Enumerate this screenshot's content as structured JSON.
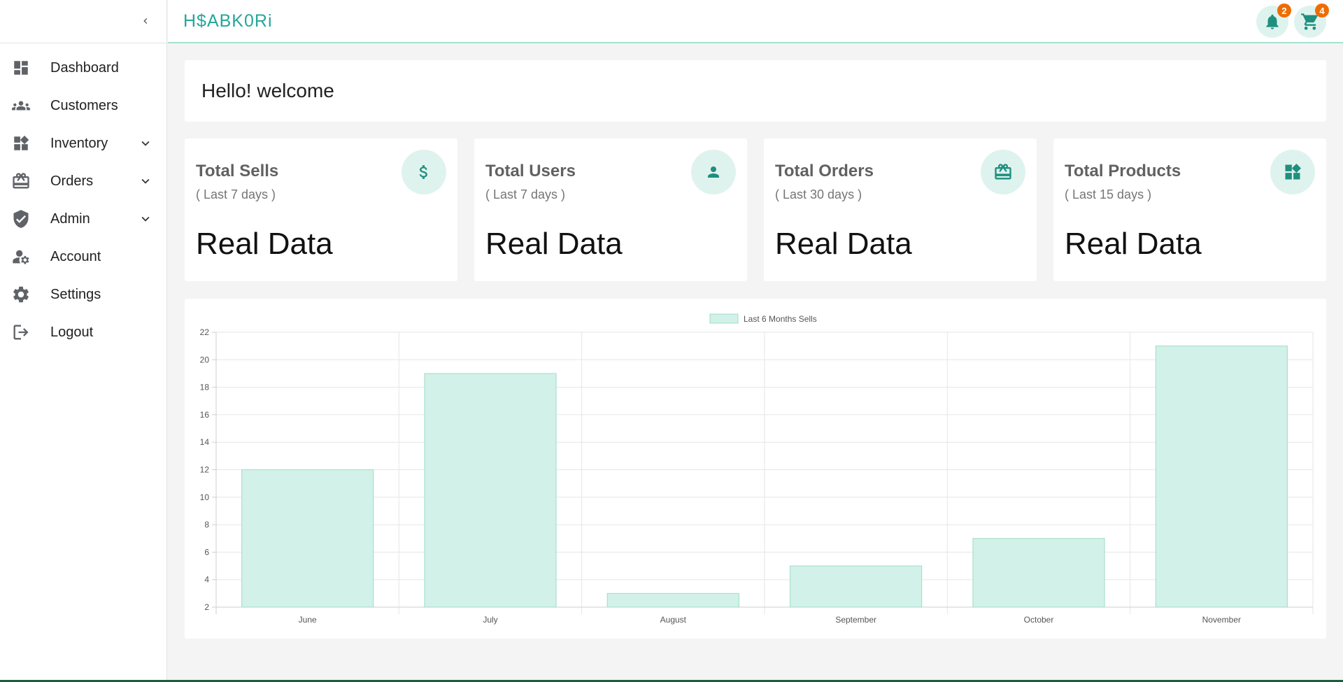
{
  "app": {
    "logo_text": "H$ABK0Ri"
  },
  "sidebar": {
    "items": [
      {
        "label": "Dashboard",
        "icon": "dashboard-icon",
        "expandable": false
      },
      {
        "label": "Customers",
        "icon": "people-icon",
        "expandable": false
      },
      {
        "label": "Inventory",
        "icon": "widgets-icon",
        "expandable": true
      },
      {
        "label": "Orders",
        "icon": "card-giftcard-icon",
        "expandable": true
      },
      {
        "label": "Admin",
        "icon": "shield-check-icon",
        "expandable": true
      },
      {
        "label": "Account",
        "icon": "manage-accounts-icon",
        "expandable": false
      },
      {
        "label": "Settings",
        "icon": "gear-icon",
        "expandable": false
      },
      {
        "label": "Logout",
        "icon": "logout-icon",
        "expandable": false
      }
    ]
  },
  "header": {
    "notifications_count": "2",
    "cart_count": "4"
  },
  "welcome": {
    "text": "Hello! welcome"
  },
  "cards": [
    {
      "title": "Total Sells",
      "subtitle": "( Last 7 days )",
      "value": "Real Data",
      "icon": "dollar-icon"
    },
    {
      "title": "Total Users",
      "subtitle": "( Last 7 days )",
      "value": "Real Data",
      "icon": "person-icon"
    },
    {
      "title": "Total Orders",
      "subtitle": "( Last 30 days )",
      "value": "Real Data",
      "icon": "card-giftcard-icon"
    },
    {
      "title": "Total Products",
      "subtitle": "( Last 15 days )",
      "value": "Real Data",
      "icon": "widgets-icon"
    }
  ],
  "colors": {
    "accent": "#26a69a",
    "bar_fill": "#d2f1e8",
    "bar_stroke": "#9fdcc8",
    "badge": "#ef6c00",
    "icon_bg": "#dff3ee",
    "icon_fg": "#1f8f7e"
  },
  "chart_data": {
    "type": "bar",
    "categories": [
      "June",
      "July",
      "August",
      "September",
      "October",
      "November"
    ],
    "series": [
      {
        "name": "Last 6 Months Sells",
        "values": [
          12,
          19,
          3,
          5,
          7,
          21
        ]
      }
    ],
    "ylim": [
      2,
      22
    ],
    "yticks": [
      2,
      4,
      6,
      8,
      10,
      12,
      14,
      16,
      18,
      20,
      22
    ],
    "grid": true,
    "legend": "top-center"
  }
}
